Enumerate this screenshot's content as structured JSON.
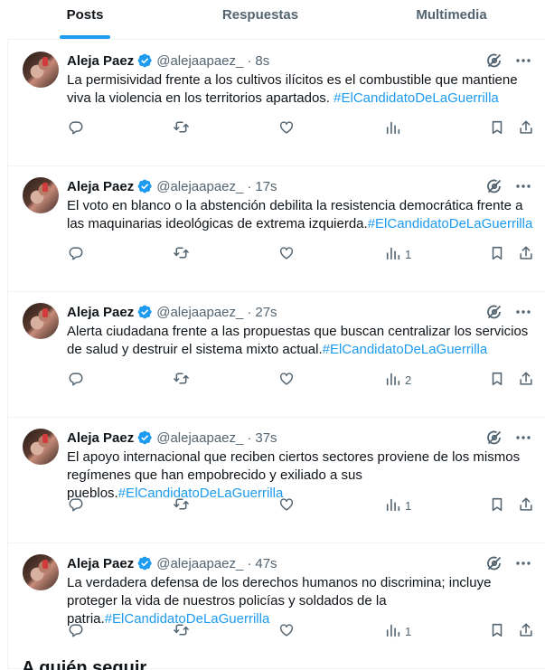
{
  "tabs": [
    {
      "label": "Posts",
      "active": true
    },
    {
      "label": "Respuestas",
      "active": false
    },
    {
      "label": "Multimedia",
      "active": false
    }
  ],
  "colors": {
    "accent": "#1d9bf0",
    "secondary_text": "#536471",
    "primary_text": "#0f1419"
  },
  "tweets": [
    {
      "author": "Aleja Paez",
      "handle": "@alejaapaez_",
      "time": "8s",
      "text": "La permisividad frente a los cultivos ilícitos es el combustible que mantiene viva la violencia en los territorios apartados. ",
      "hashtag": "#ElCandidatoDeLaGuerrilla",
      "views": ""
    },
    {
      "author": "Aleja Paez",
      "handle": "@alejaapaez_",
      "time": "17s",
      "text": "El voto en blanco o la abstención debilita la resistencia democrática frente a las maquinarias ideológicas de extrema izquierda.",
      "hashtag": "#ElCandidatoDeLaGuerrilla",
      "views": "1"
    },
    {
      "author": "Aleja Paez",
      "handle": "@alejaapaez_",
      "time": "27s",
      "text": "Alerta ciudadana frente a las propuestas que buscan centralizar los servicios de salud y destruir el sistema mixto actual.",
      "hashtag": "#ElCandidatoDeLaGuerrilla",
      "views": "2"
    },
    {
      "author": "Aleja Paez",
      "handle": "@alejaapaez_",
      "time": "37s",
      "text": "El apoyo internacional que reciben ciertos sectores proviene de los mismos regímenes que han empobrecido y exiliado a sus pueblos.",
      "hashtag": "#ElCandidatoDeLaGuerrilla",
      "views": "1"
    },
    {
      "author": "Aleja Paez",
      "handle": "@alejaapaez_",
      "time": "47s",
      "text": "La verdadera defensa de los derechos humanos no discrimina; incluye proteger la vida de nuestros policías y soldados de la patria.",
      "hashtag": "#ElCandidatoDeLaGuerrilla",
      "views": "1"
    }
  ],
  "section": {
    "who_to_follow": "A quién seguir"
  },
  "icons": {
    "verified": "verified-badge-icon",
    "grok": "grok-icon",
    "more": "more-icon",
    "reply": "reply-icon",
    "retweet": "retweet-icon",
    "like": "like-icon",
    "views": "views-icon",
    "bookmark": "bookmark-icon",
    "share": "share-icon"
  }
}
